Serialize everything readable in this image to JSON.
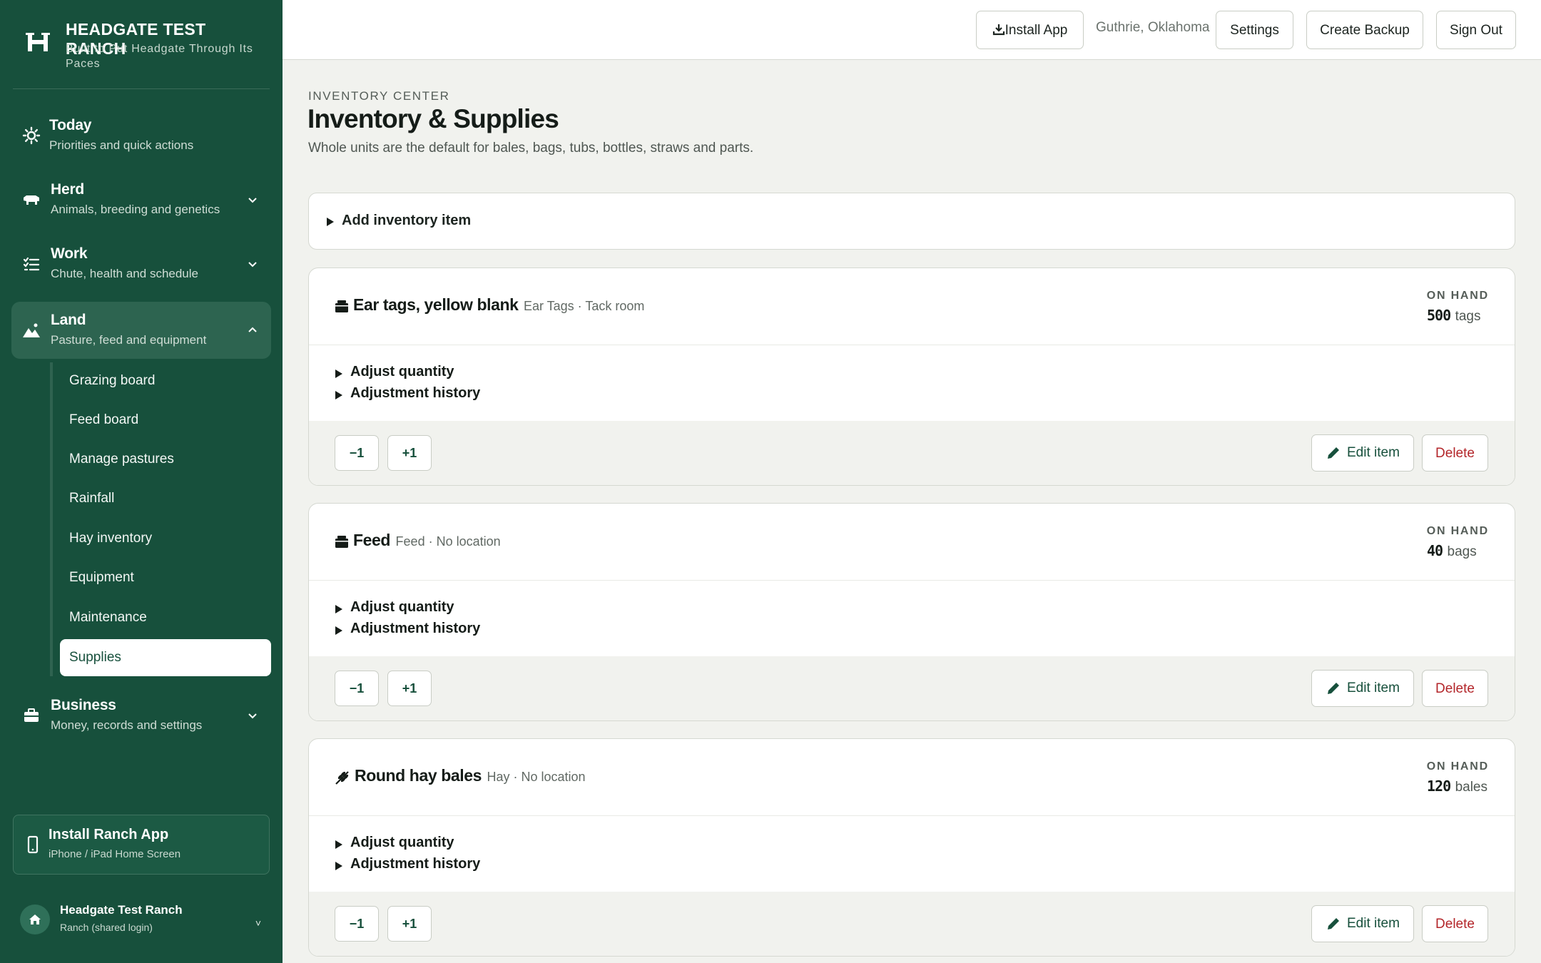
{
  "brand": {
    "title": "HEADGATE TEST RANCH",
    "subtitle": "Built to Put Headgate Through Its Paces"
  },
  "nav": [
    {
      "title": "Today",
      "subtitle": "Priorities and quick actions",
      "icon": "sun-icon"
    },
    {
      "title": "Herd",
      "subtitle": "Animals, breeding and genetics",
      "icon": "cattle-icon"
    },
    {
      "title": "Work",
      "subtitle": "Chute, health and schedule",
      "icon": "checklist-icon"
    },
    {
      "title": "Land",
      "subtitle": "Pasture, feed and equipment",
      "icon": "mountain-icon"
    },
    {
      "title": "Business",
      "subtitle": "Money, records and settings",
      "icon": "briefcase-icon"
    }
  ],
  "land_subnav": [
    "Grazing board",
    "Feed board",
    "Manage pastures",
    "Rainfall",
    "Hay inventory",
    "Equipment",
    "Maintenance",
    "Supplies"
  ],
  "install_card": {
    "title": "Install Ranch App",
    "subtitle": "iPhone / iPad Home Screen"
  },
  "account": {
    "name": "Headgate Test Ranch",
    "role": "Ranch (shared login)",
    "chevron": "˅"
  },
  "topbar": {
    "install_label": "Install App",
    "location": "Guthrie, Oklahoma",
    "settings_label": "Settings",
    "backup_label": "Create Backup",
    "signout_label": "Sign Out"
  },
  "page": {
    "eyebrow": "INVENTORY CENTER",
    "title": "Inventory & Supplies",
    "subtitle": "Whole units are the default for bales, bags, tubs, bottles, straws and parts.",
    "add_label": "Add inventory item"
  },
  "labels": {
    "on_hand": "ON HAND",
    "adjust_quantity": "Adjust quantity",
    "adjustment_history": "Adjustment history",
    "minus": "−1",
    "plus": "+1",
    "edit": "Edit item",
    "delete": "Delete"
  },
  "items": [
    {
      "name": "Ear tags, yellow blank",
      "meta": "Ear Tags · Tack room",
      "qty": "500",
      "unit": "tags",
      "icon": "box-icon"
    },
    {
      "name": "Feed",
      "meta": "Feed · No location",
      "qty": "40",
      "unit": "bags",
      "icon": "box-icon"
    },
    {
      "name": "Round hay bales",
      "meta": "Hay · No location",
      "qty": "120",
      "unit": "bales",
      "icon": "wheat-icon"
    }
  ],
  "colors": {
    "sidebar": "#17503c",
    "accent": "#17503c",
    "danger": "#b3262a",
    "background": "#f1f2ee"
  }
}
